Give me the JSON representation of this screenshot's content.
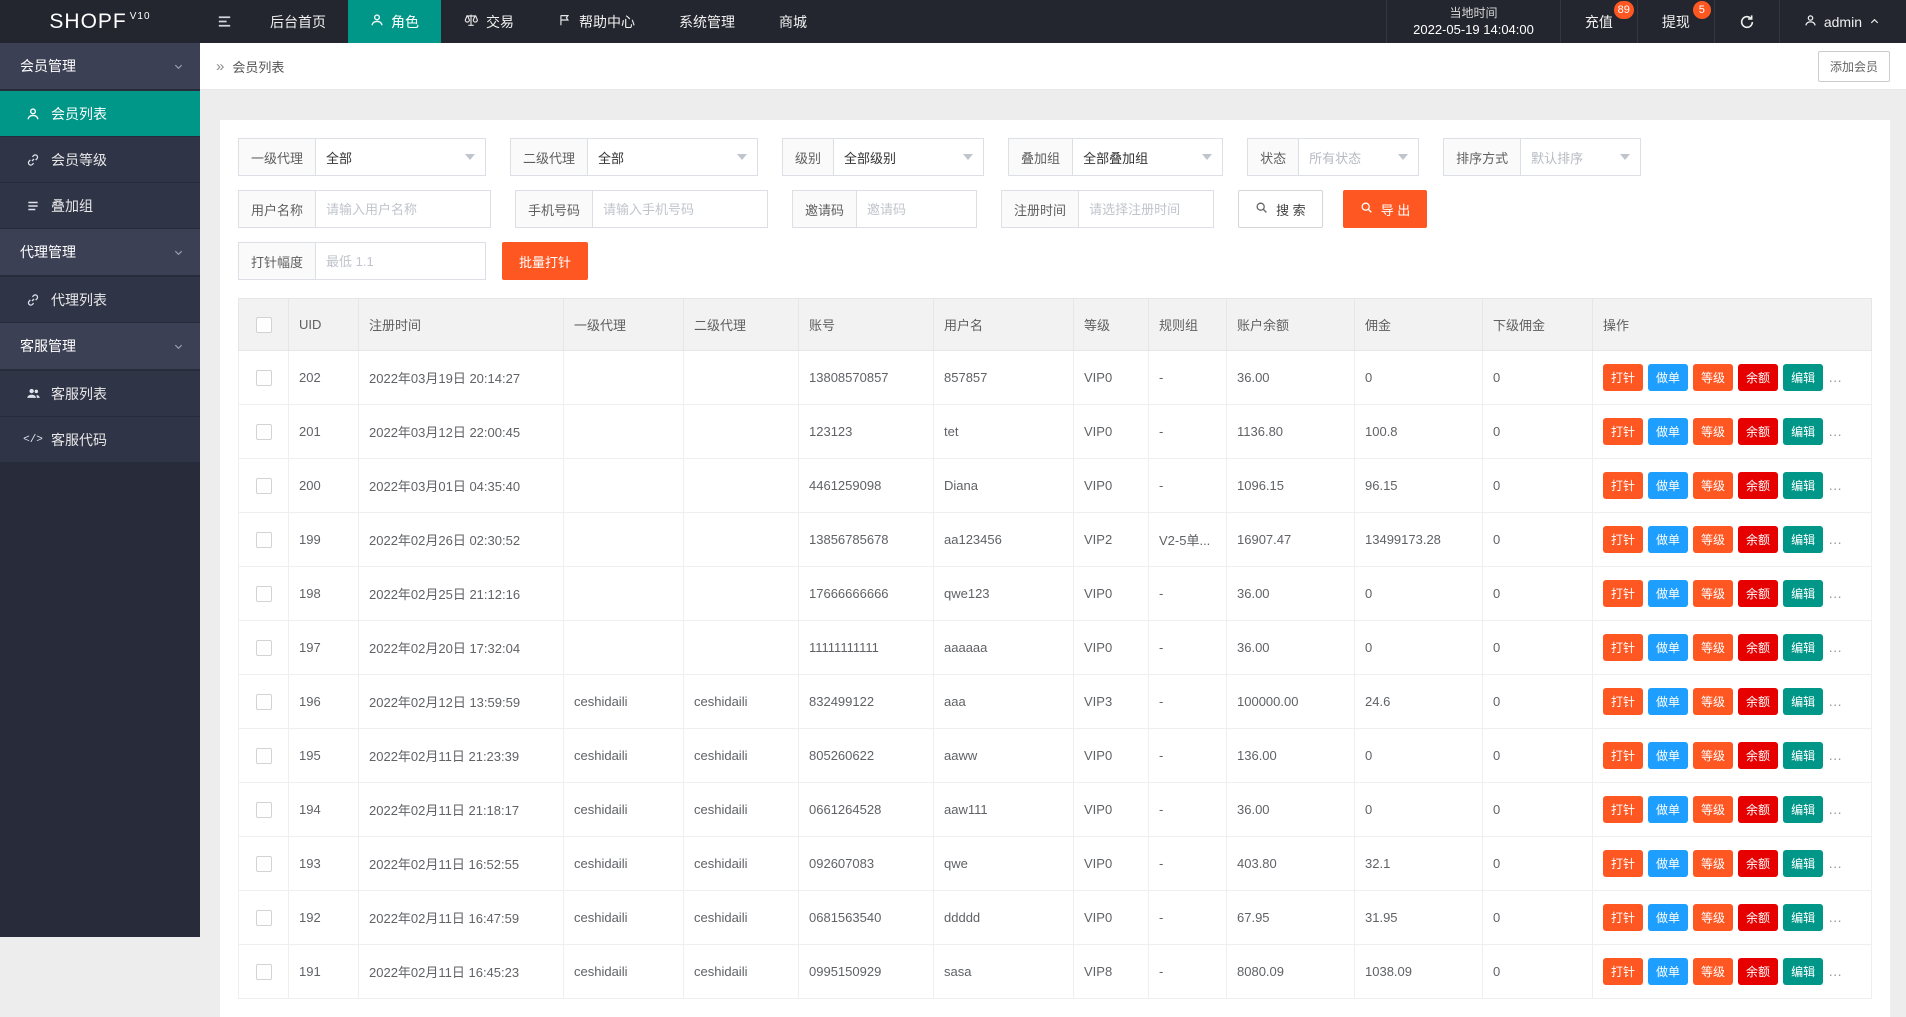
{
  "colors": {
    "teal": "#009688",
    "orange": "#ff5722",
    "blue": "#1e9fff",
    "red": "#e60000"
  },
  "topbar": {
    "logo": "SHOPF",
    "logo_version": "V10",
    "nav": [
      {
        "label": "后台首页"
      },
      {
        "label": "角色"
      },
      {
        "label": "交易"
      },
      {
        "label": "帮助中心"
      },
      {
        "label": "系统管理"
      },
      {
        "label": "商城"
      }
    ],
    "time_label": "当地时间",
    "time_value": "2022-05-19 14:04:00",
    "recharge_label": "充值",
    "recharge_badge": "89",
    "withdraw_label": "提现",
    "withdraw_badge": "5",
    "username": "admin"
  },
  "sidebar": {
    "groups": [
      {
        "label": "会员管理",
        "items": [
          {
            "label": "会员列表"
          },
          {
            "label": "会员等级"
          },
          {
            "label": "叠加组"
          }
        ]
      },
      {
        "label": "代理管理",
        "items": [
          {
            "label": "代理列表"
          }
        ]
      },
      {
        "label": "客服管理",
        "items": [
          {
            "label": "客服列表"
          },
          {
            "label": "客服代码"
          }
        ]
      }
    ]
  },
  "breadcrumb": {
    "title": "会员列表",
    "add_member_button": "添加会员"
  },
  "filters": {
    "selects": [
      {
        "label": "一级代理",
        "value": "全部"
      },
      {
        "label": "二级代理",
        "value": "全部"
      },
      {
        "label": "级别",
        "value": "全部级别"
      },
      {
        "label": "叠加组",
        "value": "全部叠加组"
      },
      {
        "label": "状态",
        "value": "所有状态"
      },
      {
        "label": "排序方式",
        "value": "默认排序"
      }
    ],
    "inputs": [
      {
        "label": "用户名称",
        "placeholder": "请输入用户名称"
      },
      {
        "label": "手机号码",
        "placeholder": "请输入手机号码"
      },
      {
        "label": "邀请码",
        "placeholder": "邀请码"
      },
      {
        "label": "注册时间",
        "placeholder": "请选择注册时间"
      }
    ],
    "search_label": "搜 索",
    "export_label": "导 出",
    "inject_label": "打针幅度",
    "inject_placeholder": "最低 1.1",
    "batch_inject_label": "批量打针"
  },
  "table": {
    "columns": [
      "UID",
      "注册时间",
      "一级代理",
      "二级代理",
      "账号",
      "用户名",
      "等级",
      "规则组",
      "账户余额",
      "佣金",
      "下级佣金",
      "操作"
    ],
    "actions": [
      {
        "name": "inject",
        "label": "打针",
        "color": "#ff5722"
      },
      {
        "name": "order",
        "label": "做单",
        "color": "#1e9fff"
      },
      {
        "name": "level",
        "label": "等级",
        "color": "#ff5722"
      },
      {
        "name": "balance",
        "label": "余额",
        "color": "#e60000"
      },
      {
        "name": "edit",
        "label": "编辑",
        "color": "#009688"
      }
    ],
    "more_label": "…",
    "rows": [
      {
        "uid": "202",
        "reg_time": "2022年03月19日 20:14:27",
        "agent1": "",
        "agent2": "",
        "account": "13808570857",
        "username": "857857",
        "level": "VIP0",
        "rule_group": "-",
        "balance": "36.00",
        "commission": "0",
        "sub_commission": "0"
      },
      {
        "uid": "201",
        "reg_time": "2022年03月12日 22:00:45",
        "agent1": "",
        "agent2": "",
        "account": "123123",
        "username": "tet",
        "level": "VIP0",
        "rule_group": "-",
        "balance": "1136.80",
        "commission": "100.8",
        "sub_commission": "0"
      },
      {
        "uid": "200",
        "reg_time": "2022年03月01日 04:35:40",
        "agent1": "",
        "agent2": "",
        "account": "4461259098",
        "username": "Diana",
        "level": "VIP0",
        "rule_group": "-",
        "balance": "1096.15",
        "commission": "96.15",
        "sub_commission": "0"
      },
      {
        "uid": "199",
        "reg_time": "2022年02月26日 02:30:52",
        "agent1": "",
        "agent2": "",
        "account": "13856785678",
        "username": "aa123456",
        "level": "VIP2",
        "rule_group": "V2-5单...",
        "balance": "16907.47",
        "commission": "13499173.28",
        "sub_commission": "0"
      },
      {
        "uid": "198",
        "reg_time": "2022年02月25日 21:12:16",
        "agent1": "",
        "agent2": "",
        "account": "17666666666",
        "username": "qwe123",
        "level": "VIP0",
        "rule_group": "-",
        "balance": "36.00",
        "commission": "0",
        "sub_commission": "0"
      },
      {
        "uid": "197",
        "reg_time": "2022年02月20日 17:32:04",
        "agent1": "",
        "agent2": "",
        "account": "11111111111",
        "username": "aaaaaa",
        "level": "VIP0",
        "rule_group": "-",
        "balance": "36.00",
        "commission": "0",
        "sub_commission": "0"
      },
      {
        "uid": "196",
        "reg_time": "2022年02月12日 13:59:59",
        "agent1": "ceshidaili",
        "agent2": "ceshidaili",
        "account": "832499122",
        "username": "aaa",
        "level": "VIP3",
        "rule_group": "-",
        "balance": "100000.00",
        "commission": "24.6",
        "sub_commission": "0"
      },
      {
        "uid": "195",
        "reg_time": "2022年02月11日 21:23:39",
        "agent1": "ceshidaili",
        "agent2": "ceshidaili",
        "account": "805260622",
        "username": "aaww",
        "level": "VIP0",
        "rule_group": "-",
        "balance": "136.00",
        "commission": "0",
        "sub_commission": "0"
      },
      {
        "uid": "194",
        "reg_time": "2022年02月11日 21:18:17",
        "agent1": "ceshidaili",
        "agent2": "ceshidaili",
        "account": "0661264528",
        "username": "aaw111",
        "level": "VIP0",
        "rule_group": "-",
        "balance": "36.00",
        "commission": "0",
        "sub_commission": "0"
      },
      {
        "uid": "193",
        "reg_time": "2022年02月11日 16:52:55",
        "agent1": "ceshidaili",
        "agent2": "ceshidaili",
        "account": "092607083",
        "username": "qwe",
        "level": "VIP0",
        "rule_group": "-",
        "balance": "403.80",
        "commission": "32.1",
        "sub_commission": "0"
      },
      {
        "uid": "192",
        "reg_time": "2022年02月11日 16:47:59",
        "agent1": "ceshidaili",
        "agent2": "ceshidaili",
        "account": "0681563540",
        "username": "ddddd",
        "level": "VIP0",
        "rule_group": "-",
        "balance": "67.95",
        "commission": "31.95",
        "sub_commission": "0"
      },
      {
        "uid": "191",
        "reg_time": "2022年02月11日 16:45:23",
        "agent1": "ceshidaili",
        "agent2": "ceshidaili",
        "account": "0995150929",
        "username": "sasa",
        "level": "VIP8",
        "rule_group": "-",
        "balance": "8080.09",
        "commission": "1038.09",
        "sub_commission": "0"
      }
    ]
  }
}
